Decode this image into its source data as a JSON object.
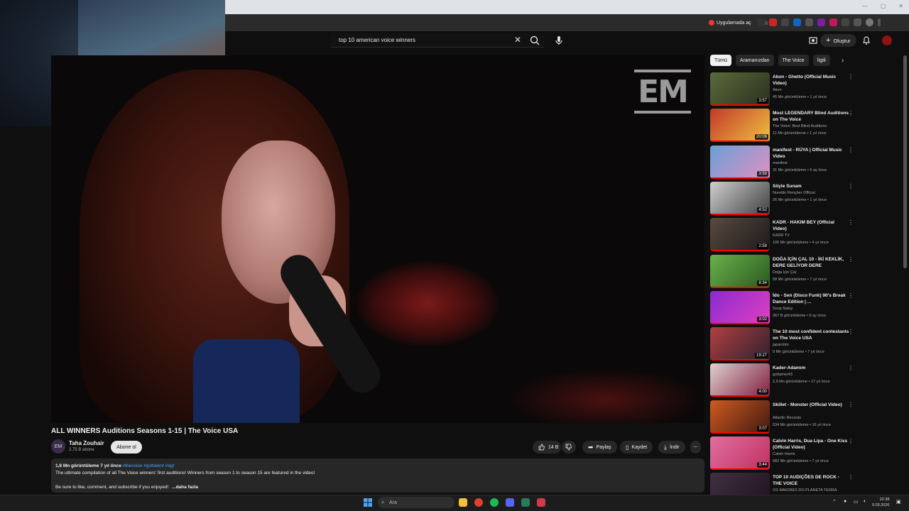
{
  "browser": {
    "app_button_label": "Uygulamada aç"
  },
  "header": {
    "search_query": "top 10 american voice winners",
    "create_label": "Oluştur"
  },
  "video": {
    "title": "ALL WINNERS Auditions Seasons 1-15 | The Voice USA",
    "watermark": "EM",
    "channel": {
      "avatar_text": "EM",
      "name": "Taha Zouhair",
      "subscribers": "2,75 B abone",
      "subscribe_label": "Abone ol"
    },
    "actions": {
      "likes": "14 B",
      "share": "Paylaş",
      "save": "Kaydet",
      "download": "İndir"
    },
    "description": {
      "meta": "1,8 Mn görüntüleme  7 yıl önce",
      "tags": "#thevoice #gottalent #agt",
      "line1": "The ultimate compilation of all The Voice winners' first auditions! Winners from season 1 to season 15 are featured in the video!",
      "line2": "Be sure to like, comment, and subscribe if you enjoyed!",
      "more": "...daha fazla"
    }
  },
  "chips": [
    "Tümü",
    "Aramanızdan",
    "The Voice",
    "İlgili"
  ],
  "recommendations": [
    {
      "title": "Akon - Ghetto (Official Music Video)",
      "channel": "Akon",
      "meta": "45 Mn görüntüleme • 1 yıl önce",
      "duration": "3:57",
      "colors": [
        "#5a6a3a",
        "#2a3020"
      ]
    },
    {
      "title": "Most LEGENDARY Blind Auditions on The Voice",
      "channel": "The Voice: Best Blind Auditions",
      "meta": "11 Mn görüntüleme • 1 yıl önce",
      "duration": "20:06",
      "colors": [
        "#c23a2a",
        "#f0c040"
      ]
    },
    {
      "title": "manifest - RÜYA | Official Music Video",
      "channel": "manifest",
      "meta": "31 Mn görüntüleme • 5 ay önce",
      "duration": "3:58",
      "colors": [
        "#6aa0d8",
        "#e090c0"
      ]
    },
    {
      "title": "Söyle Sunam",
      "channel": "Nurettin Rençber Official",
      "meta": "26 Mn görüntüleme • 1 yıl önce",
      "duration": "4:52",
      "colors": [
        "#cfcfcf",
        "#404040"
      ]
    },
    {
      "title": "KADR - HAKIM BEY  (Official Video)",
      "channel": "KADR TV",
      "meta": "105 Mn görüntüleme • 4 yıl önce",
      "duration": "2:59",
      "colors": [
        "#5a4a40",
        "#1a1a1a"
      ]
    },
    {
      "title": "DOĞA İÇİN ÇAL 10 - İKİ KEKLİK, DERE GELİYOR DERE",
      "channel": "Doğa İçin Çal",
      "meta": "58 Mn görüntüleme • 7 yıl önce",
      "duration": "8:34",
      "colors": [
        "#6ab04a",
        "#2a5a20"
      ]
    },
    {
      "title": "İdo - Sen (Disco Funk) 90's Break Dance Edition | ...",
      "channel": "Soup Natsy",
      "meta": "367 B görüntüleme • 5 ay önce",
      "duration": "3:02",
      "colors": [
        "#8a2ad0",
        "#e040c0"
      ]
    },
    {
      "title": "The 10 most confident contestants on The Voice USA",
      "channel": "japaroldo",
      "meta": "9 Mn görüntüleme • 7 yıl önce",
      "duration": "19:27",
      "colors": [
        "#b04040",
        "#302030"
      ]
    },
    {
      "title": "Kader-Adamım",
      "channel": "gottamer43",
      "meta": "2,9 Mn görüntüleme • 17 yıl önce",
      "duration": "4:00",
      "colors": [
        "#e0d0d0",
        "#802040"
      ]
    },
    {
      "title": "Skillet - Monster (Official Video)",
      "channel": "Atlantic Records",
      "meta": "534 Mn görüntüleme • 16 yıl önce",
      "duration": "3:07",
      "colors": [
        "#d05a20",
        "#401a10"
      ]
    },
    {
      "title": "Calvin Harris, Dua Lipa - One Kiss (Official Video)",
      "channel": "Calvin Harris",
      "meta": "982 Mn görüntüleme • 7 yıl önce",
      "duration": "3:44",
      "colors": [
        "#e070a0",
        "#c03060"
      ]
    },
    {
      "title": "TOP 10 AUDIÇÕES DE ROCK - THE VOICE",
      "channel": "OS MAIORES DO PLANETA TERRA",
      "meta": "",
      "duration": "",
      "colors": [
        "#403040",
        "#201020"
      ]
    }
  ],
  "taskbar": {
    "search_placeholder": "Ara",
    "time": "22:38",
    "date": "9.03.2026"
  }
}
